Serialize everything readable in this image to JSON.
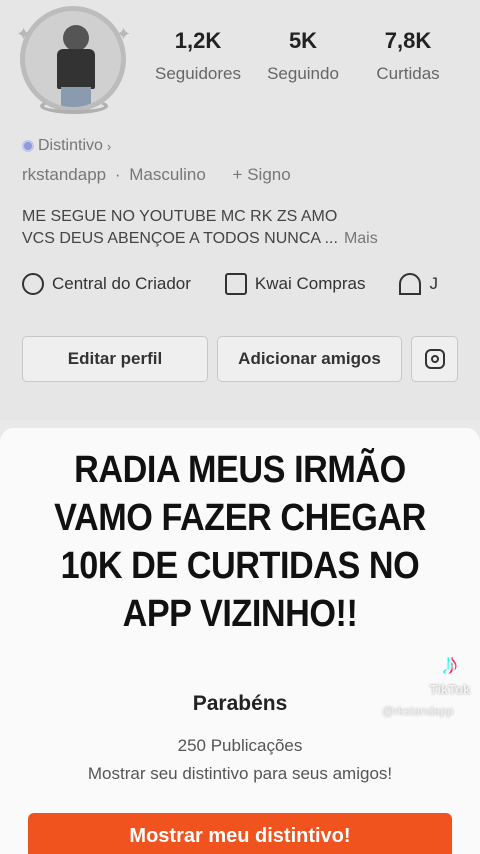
{
  "profile": {
    "stats": [
      {
        "value": "1,2K",
        "label": "Seguidores"
      },
      {
        "value": "5K",
        "label": "Seguindo"
      },
      {
        "value": "7,8K",
        "label": "Curtidas"
      }
    ],
    "badge_link": "Distintivo",
    "username": "rkstandapp",
    "gender": "Masculino",
    "sign": "+ Signo",
    "bio_line1": "ME SEGUE NO YOUTUBE MC RK ZS AMO",
    "bio_line2": "VCS DEUS ABENÇOE A TODOS NUNCA ...",
    "bio_more": "Mais",
    "shortcuts": [
      {
        "label": "Central do Criador",
        "icon": "lightning-circle-icon"
      },
      {
        "label": "Kwai Compras",
        "icon": "shopping-bag-icon"
      },
      {
        "label": "J",
        "icon": "dome-icon"
      }
    ],
    "edit_button": "Editar perfil",
    "add_friends_button": "Adicionar amigos",
    "instagram_icon": "instagram-icon"
  },
  "overlay": {
    "lines": [
      "RADIA MEUS IRMÃO",
      "VAMO FAZER CHEGAR",
      "10K DE CURTIDAS NO",
      "APP VIZINHO!!"
    ]
  },
  "watermark": {
    "brand": "TikTok",
    "user": "@rkstandapp"
  },
  "modal": {
    "title": "Parabéns",
    "publications": "250 Publicações",
    "subtitle": "Mostrar seu distintivo para seus amigos!",
    "cta": "Mostrar meu distintivo!"
  },
  "colors": {
    "cta_bg": "#f1531f",
    "badge_dot": "#8f9ad8"
  }
}
